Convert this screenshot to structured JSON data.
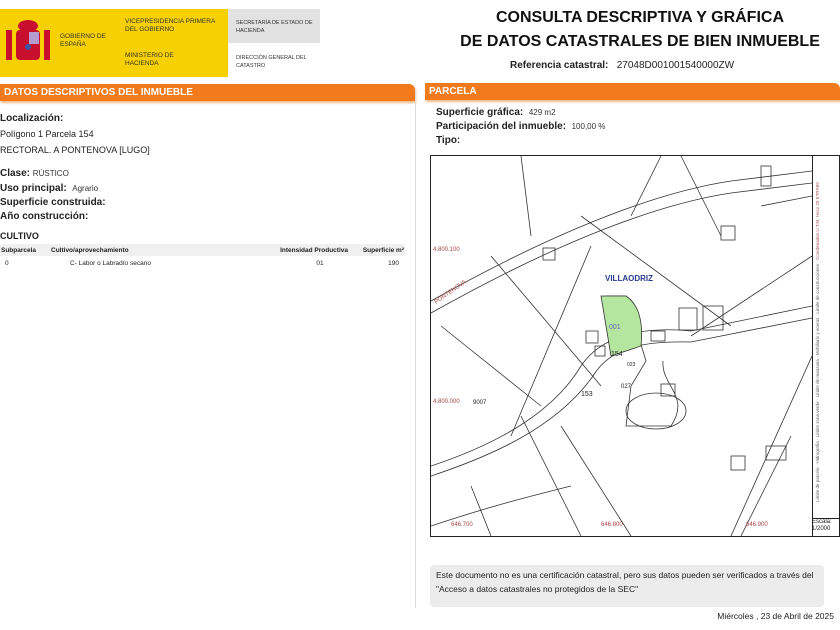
{
  "header": {
    "gov": "GOBIERNO DE ESPAÑA",
    "vice": "VICEPRESIDENCIA PRIMERA DEL GOBIERNO",
    "ministry": "MINISTERIO DE HACIENDA",
    "secretaria": "SECRETARÍA DE ESTADO DE HACIENDA",
    "direccion": "DIRECCIÓN GENERAL DEL CATASTRO",
    "title1": "CONSULTA DESCRIPTIVA Y GRÁFICA",
    "title2": "DE DATOS CATASTRALES DE BIEN INMUEBLE",
    "ref_label": "Referencia catastral:",
    "ref_value": "27048D001001540000ZW"
  },
  "left": {
    "section": "DATOS DESCRIPTIVOS DEL INMUEBLE",
    "loc_label": "Localización:",
    "loc1": "Polígono 1 Parcela 154",
    "loc2": "RECTORAL. A PONTENOVA [LUGO]",
    "clase_label": "Clase:",
    "clase": "RÚSTICO",
    "uso_label": "Uso principal:",
    "uso": "Agrario",
    "sup_label": "Superficie construida:",
    "ano_label": "Año construcción:",
    "cultivo": "CULTIVO",
    "columns": [
      "Subparcela",
      "Cultivo/aprovechamiento",
      "Intensidad Productiva",
      "Superficie m²"
    ],
    "rows": [
      [
        "0",
        "C- Labor o Labradío secano",
        "01",
        "190"
      ]
    ]
  },
  "right": {
    "section": "PARCELA",
    "sg_label": "Superficie gráfica:",
    "sg": "429 m2",
    "part_label": "Participación del inmueble:",
    "part": "100,00 %",
    "tipo_label": "Tipo:",
    "map": {
      "place": "VILLAODRIZ",
      "road": "PONTENOVA",
      "parcel": "154",
      "parcel2": "153",
      "sub1": "001",
      "sub2": "023",
      "sub3": "027",
      "road2": "9007",
      "y1": "4.800.100",
      "y2": "4.800.000",
      "x1": "646.800",
      "x2": "646.900",
      "x3": "646.700"
    },
    "legend": [
      "Límite de parcela",
      "Hidrografía",
      "Límite zona verde",
      "Límite de manzana",
      "Mobiliario y aceras",
      "Límite de construcciones",
      "Coordenadas U.T.M. Huso 29 ETRS89"
    ],
    "scale_label": "Escala:",
    "scale": "1/2000",
    "disclaimer": "Este documento no es una certificación catastral, pero sus datos pueden ser verificados a través del \"Acceso a datos catastrales no protegidos de la SEC\"",
    "date": "Miércoles , 23 de Abril de 2025"
  }
}
